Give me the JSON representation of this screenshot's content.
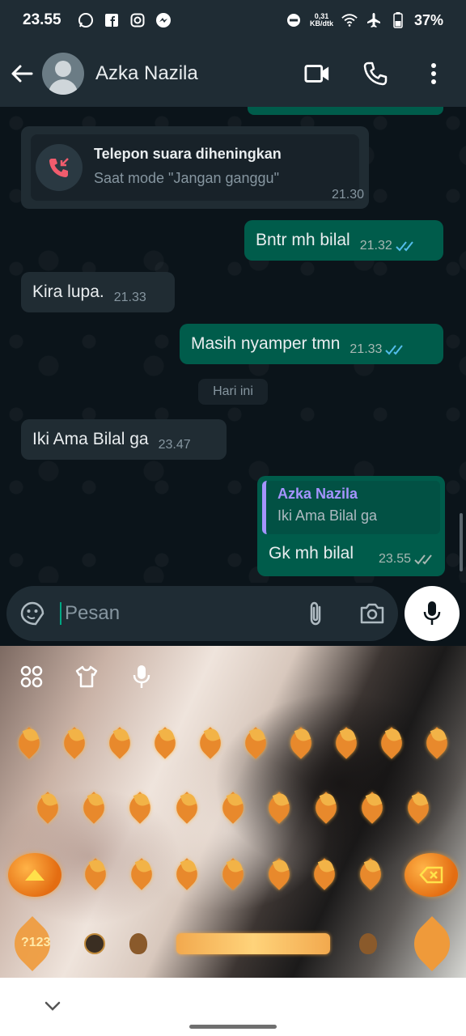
{
  "status_bar": {
    "time": "23.55",
    "net_speed_value": "0,31",
    "net_speed_unit": "KB/dtk",
    "battery": "37%",
    "notification_icons": [
      "whatsapp-icon",
      "facebook-icon",
      "instagram-icon",
      "messenger-icon"
    ]
  },
  "header": {
    "contact_name": "Azka Nazila",
    "icons": [
      "back-arrow-icon",
      "video-call-icon",
      "voice-call-icon",
      "more-options-icon"
    ]
  },
  "chat": {
    "missed_call": {
      "title": "Telepon suara diheningkan",
      "subtitle": "Saat mode \"Jangan ganggu\"",
      "time": "21.30"
    },
    "messages": [
      {
        "direction": "out",
        "text": "Bntr mh bilal",
        "time": "21.32",
        "status": "read"
      },
      {
        "direction": "in",
        "text": "Kira lupa.",
        "time": "21.33"
      },
      {
        "direction": "out",
        "text": "Masih nyamper tmn",
        "time": "21.33",
        "status": "read"
      },
      {
        "direction": "in",
        "text": "Iki Ama Bilal ga",
        "time": "23.47"
      }
    ],
    "day_divider": "Hari ini",
    "reply_message": {
      "quoted_name": "Azka Nazila",
      "quoted_text": "Iki Ama Bilal ga",
      "text": "Gk mh bilal",
      "time": "23.55",
      "status": "delivered"
    }
  },
  "composer": {
    "placeholder": "Pesan",
    "icons": [
      "emoji-sticker-icon",
      "attach-icon",
      "camera-icon",
      "microphone-icon"
    ]
  },
  "keyboard": {
    "numeric_key": "?123",
    "theme": "autumn-leaves-photo",
    "colors": {
      "leaf": "#e8892c",
      "pumpkin": "#e46d12",
      "highlight": "#ffe14a"
    }
  },
  "colors": {
    "chat_bg": "#0b141a",
    "header_bg": "#1f2c34",
    "bubble_out": "#005c4b",
    "bubble_in": "#202c33",
    "read_tick": "#53bdeb",
    "accent": "#00a884",
    "quote_name": "#a594ff"
  }
}
